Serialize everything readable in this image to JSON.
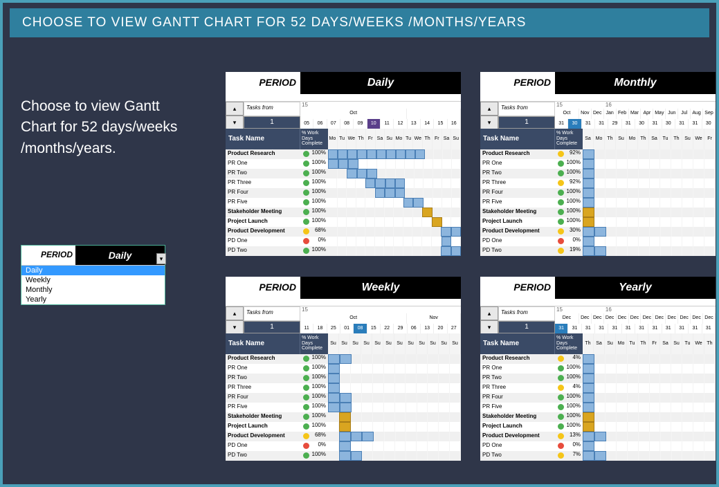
{
  "title_bar": "CHOOSE TO VIEW GANTT CHART FOR 52 DAYS/WEEKS /MONTHS/YEARS",
  "intro_text": "Choose to view Gantt Chart for 52 days/weeks /months/years.",
  "period_label": "PERIOD",
  "period_value": "Daily",
  "period_options": [
    "Daily",
    "Weekly",
    "Monthly",
    "Yearly"
  ],
  "tasks_from_label": "Tasks from",
  "task_name_header": "Task Name",
  "pct_header": "% Work Days Complete",
  "spinner_value": "1",
  "chart_data": [
    {
      "id": "daily",
      "title": "Daily",
      "year": "15",
      "month": "Oct",
      "columns": [
        "Mo",
        "Tu",
        "We",
        "Th",
        "Fr",
        "Sa",
        "Su",
        "Mo",
        "Tu",
        "We",
        "Th",
        "Fr",
        "Sa",
        "Su"
      ],
      "day_numbers": [
        "05",
        "06",
        "07",
        "08",
        "09",
        "10",
        "11",
        "12",
        "13",
        "14",
        "15",
        "16"
      ],
      "highlight_col": 5,
      "tasks": [
        {
          "name": "Product Research",
          "bold": true,
          "status": "green",
          "pct": "100%",
          "bars": [
            0,
            1,
            2,
            3,
            4,
            5,
            6,
            7,
            8,
            9
          ]
        },
        {
          "name": "PR One",
          "status": "green",
          "pct": "100%",
          "bars": [
            0,
            1,
            2
          ]
        },
        {
          "name": "PR Two",
          "status": "green",
          "pct": "100%",
          "bars": [
            2,
            3,
            4
          ]
        },
        {
          "name": "PR Three",
          "status": "green",
          "pct": "100%",
          "bars": [
            4,
            5,
            6,
            7
          ]
        },
        {
          "name": "PR Four",
          "status": "green",
          "pct": "100%",
          "bars": [
            5,
            6,
            7
          ]
        },
        {
          "name": "PR Five",
          "status": "green",
          "pct": "100%",
          "bars": [
            8,
            9
          ]
        },
        {
          "name": "Stakeholder Meeting",
          "bold": true,
          "status": "green",
          "pct": "100%",
          "bars": [
            10
          ],
          "gold": true
        },
        {
          "name": "Project Launch",
          "bold": true,
          "status": "green",
          "pct": "100%",
          "bars": [
            11
          ],
          "gold": true
        },
        {
          "name": "Product Development",
          "bold": true,
          "status": "yellow",
          "pct": "68%",
          "bars": [
            12,
            13
          ]
        },
        {
          "name": "PD One",
          "status": "red",
          "pct": "0%",
          "bars": [
            12
          ]
        },
        {
          "name": "PD Two",
          "status": "green",
          "pct": "100%",
          "bars": [
            12,
            13
          ]
        }
      ]
    },
    {
      "id": "monthly",
      "title": "Monthly",
      "year": "15",
      "year2": "16",
      "months": [
        "Oct",
        "Nov",
        "Dec",
        "Jan",
        "Feb",
        "Mar",
        "Apr",
        "May",
        "Jun",
        "Jul",
        "Aug",
        "Sep"
      ],
      "day_numbers": [
        "31",
        "30",
        "31",
        "31",
        "29",
        "31",
        "30",
        "31",
        "30",
        "31",
        "31",
        "30"
      ],
      "columns": [
        "Sa",
        "Mo",
        "Th",
        "Su",
        "Mo",
        "Th",
        "Sa",
        "Tu",
        "Th",
        "Su",
        "We",
        "Fr"
      ],
      "highlight_col": 1,
      "tasks": [
        {
          "name": "Product Research",
          "bold": true,
          "status": "yellow",
          "pct": "92%",
          "bars": [
            0
          ]
        },
        {
          "name": "PR One",
          "status": "green",
          "pct": "100%",
          "bars": [
            0
          ]
        },
        {
          "name": "PR Two",
          "status": "green",
          "pct": "100%",
          "bars": [
            0
          ]
        },
        {
          "name": "PR Three",
          "status": "yellow",
          "pct": "92%",
          "bars": [
            0
          ]
        },
        {
          "name": "PR Four",
          "status": "green",
          "pct": "100%",
          "bars": [
            0
          ]
        },
        {
          "name": "PR Five",
          "status": "green",
          "pct": "100%",
          "bars": [
            0
          ]
        },
        {
          "name": "Stakeholder Meeting",
          "bold": true,
          "status": "green",
          "pct": "100%",
          "bars": [
            0
          ],
          "gold": true
        },
        {
          "name": "Project Launch",
          "bold": true,
          "status": "green",
          "pct": "100%",
          "bars": [
            0
          ],
          "gold": true
        },
        {
          "name": "Product Development",
          "bold": true,
          "status": "yellow",
          "pct": "30%",
          "bars": [
            0,
            1
          ]
        },
        {
          "name": "PD One",
          "status": "red",
          "pct": "0%",
          "bars": [
            0
          ]
        },
        {
          "name": "PD Two",
          "status": "yellow",
          "pct": "19%",
          "bars": [
            0,
            1
          ]
        }
      ]
    },
    {
      "id": "weekly",
      "title": "Weekly",
      "year": "15",
      "month": "Oct",
      "month2": "Nov",
      "day_numbers": [
        "11",
        "18",
        "25",
        "01",
        "08",
        "15",
        "22",
        "29",
        "06",
        "13",
        "20",
        "27"
      ],
      "columns": [
        "Su",
        "Su",
        "Su",
        "Su",
        "Su",
        "Su",
        "Su",
        "Su",
        "Su",
        "Su",
        "Su",
        "Su"
      ],
      "highlight_col": 4,
      "tasks": [
        {
          "name": "Product Research",
          "bold": true,
          "status": "green",
          "pct": "100%",
          "bars": [
            0,
            1
          ]
        },
        {
          "name": "PR One",
          "status": "green",
          "pct": "100%",
          "bars": [
            0
          ]
        },
        {
          "name": "PR Two",
          "status": "green",
          "pct": "100%",
          "bars": [
            0
          ]
        },
        {
          "name": "PR Three",
          "status": "green",
          "pct": "100%",
          "bars": [
            0
          ]
        },
        {
          "name": "PR Four",
          "status": "green",
          "pct": "100%",
          "bars": [
            0,
            1
          ]
        },
        {
          "name": "PR Five",
          "status": "green",
          "pct": "100%",
          "bars": [
            0,
            1
          ]
        },
        {
          "name": "Stakeholder Meeting",
          "bold": true,
          "status": "green",
          "pct": "100%",
          "bars": [
            1
          ],
          "gold": true
        },
        {
          "name": "Project Launch",
          "bold": true,
          "status": "green",
          "pct": "100%",
          "bars": [
            1
          ],
          "gold": true
        },
        {
          "name": "Product Development",
          "bold": true,
          "status": "yellow",
          "pct": "68%",
          "bars": [
            1,
            2,
            3
          ]
        },
        {
          "name": "PD One",
          "status": "red",
          "pct": "0%",
          "bars": [
            1
          ]
        },
        {
          "name": "PD Two",
          "status": "green",
          "pct": "100%",
          "bars": [
            1,
            2
          ]
        }
      ]
    },
    {
      "id": "yearly",
      "title": "Yearly",
      "year": "15",
      "year2": "16",
      "months": [
        "Dec",
        "Dec",
        "Dec",
        "Dec",
        "Dec",
        "Dec",
        "Dec",
        "Dec",
        "Dec",
        "Dec",
        "Dec",
        "Dec"
      ],
      "day_numbers": [
        "31",
        "31",
        "31",
        "31",
        "31",
        "31",
        "31",
        "31",
        "31",
        "31",
        "31",
        "31"
      ],
      "columns": [
        "Th",
        "Sa",
        "Su",
        "Mo",
        "Tu",
        "Th",
        "Fr",
        "Sa",
        "Su",
        "Tu",
        "We",
        "Th"
      ],
      "highlight_col": 0,
      "tasks": [
        {
          "name": "Product Research",
          "bold": true,
          "status": "yellow",
          "pct": "4%",
          "bars": [
            0
          ]
        },
        {
          "name": "PR One",
          "status": "green",
          "pct": "100%",
          "bars": [
            0
          ]
        },
        {
          "name": "PR Two",
          "status": "green",
          "pct": "100%",
          "bars": [
            0
          ]
        },
        {
          "name": "PR Three",
          "status": "yellow",
          "pct": "4%",
          "bars": [
            0
          ]
        },
        {
          "name": "PR Four",
          "status": "green",
          "pct": "100%",
          "bars": [
            0
          ]
        },
        {
          "name": "PR Five",
          "status": "green",
          "pct": "100%",
          "bars": [
            0
          ]
        },
        {
          "name": "Stakeholder Meeting",
          "bold": true,
          "status": "green",
          "pct": "100%",
          "bars": [
            0
          ],
          "gold": true
        },
        {
          "name": "Project Launch",
          "bold": true,
          "status": "green",
          "pct": "100%",
          "bars": [
            0
          ],
          "gold": true
        },
        {
          "name": "Product Development",
          "bold": true,
          "status": "yellow",
          "pct": "13%",
          "bars": [
            0,
            1
          ]
        },
        {
          "name": "PD One",
          "status": "red",
          "pct": "0%",
          "bars": [
            0
          ]
        },
        {
          "name": "PD Two",
          "status": "yellow",
          "pct": "7%",
          "bars": [
            0,
            1
          ]
        }
      ]
    }
  ]
}
